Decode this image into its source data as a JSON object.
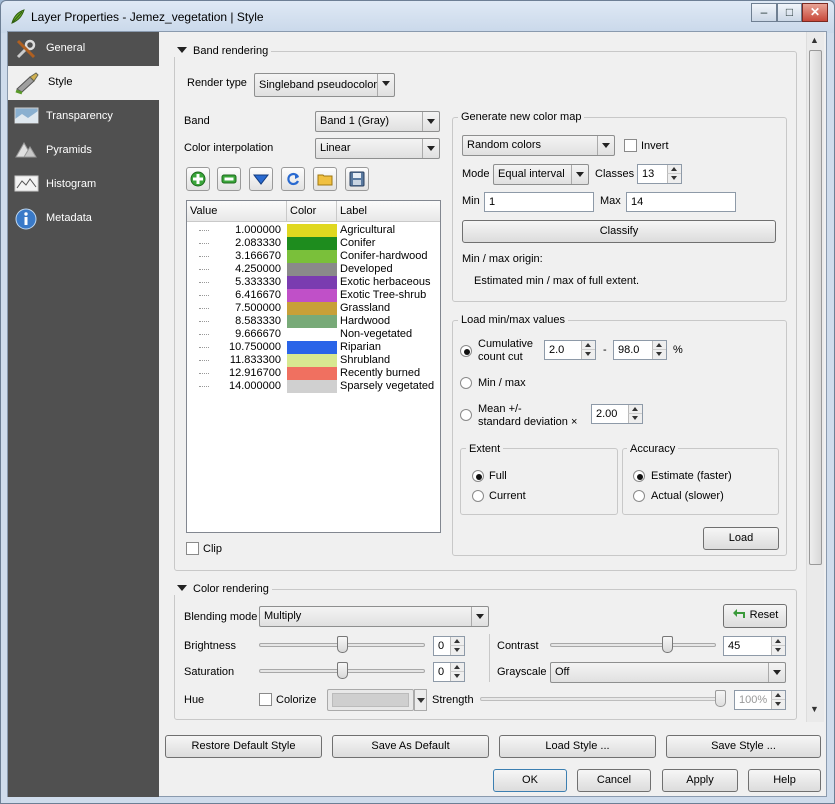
{
  "window": {
    "title": "Layer Properties - Jemez_vegetation | Style",
    "min": "–",
    "max": "□",
    "close": "✕"
  },
  "sidebar": {
    "items": [
      {
        "label": "General",
        "icon": "wrench-icon"
      },
      {
        "label": "Style",
        "icon": "paintbrush-icon"
      },
      {
        "label": "Transparency",
        "icon": "transparency-icon"
      },
      {
        "label": "Pyramids",
        "icon": "pyramids-icon"
      },
      {
        "label": "Histogram",
        "icon": "histogram-icon"
      },
      {
        "label": "Metadata",
        "icon": "info-icon"
      }
    ],
    "active": 1
  },
  "band_rendering": {
    "title": "Band rendering",
    "render_type_label": "Render type",
    "render_type_value": "Singleband pseudocolor",
    "band_label": "Band",
    "band_value": "Band 1 (Gray)",
    "interp_label": "Color interpolation",
    "interp_value": "Linear",
    "table": {
      "headers": [
        "Value",
        "Color",
        "Label"
      ],
      "rows": [
        {
          "value": "1.000000",
          "color": "#e0d820",
          "label": "Agricultural"
        },
        {
          "value": "2.083330",
          "color": "#1e8c1e",
          "label": "Conifer"
        },
        {
          "value": "3.166670",
          "color": "#7ac03a",
          "label": "Conifer-hardwood"
        },
        {
          "value": "4.250000",
          "color": "#8a8a8a",
          "label": "Developed"
        },
        {
          "value": "5.333330",
          "color": "#7a3cb0",
          "label": "Exotic herbaceous"
        },
        {
          "value": "6.416670",
          "color": "#c050c8",
          "label": "Exotic Tree-shrub"
        },
        {
          "value": "7.500000",
          "color": "#c8a038",
          "label": "Grassland"
        },
        {
          "value": "8.583330",
          "color": "#78aa78",
          "label": "Hardwood"
        },
        {
          "value": "9.666670",
          "color": "#ffffff",
          "label": "Non-vegetated"
        },
        {
          "value": "10.750000",
          "color": "#2a64e8",
          "label": "Riparian"
        },
        {
          "value": "11.833300",
          "color": "#d8e890",
          "label": "Shrubland"
        },
        {
          "value": "12.916700",
          "color": "#f07060",
          "label": "Recently burned"
        },
        {
          "value": "14.000000",
          "color": "#d0d0d0",
          "label": "Sparsely vegetated"
        }
      ]
    },
    "clip_label": "Clip"
  },
  "generate": {
    "title": "Generate new color map",
    "ramp_value": "Random colors",
    "invert_label": "Invert",
    "mode_label": "Mode",
    "mode_value": "Equal interval",
    "classes_label": "Classes",
    "classes_value": "13",
    "min_label": "Min",
    "min_value": "1",
    "max_label": "Max",
    "max_value": "14",
    "classify_label": "Classify",
    "origin_label": "Min / max origin:",
    "origin_value": "Estimated min / max of full extent."
  },
  "minmax": {
    "title": "Load min/max values",
    "cumulative_label_1": "Cumulative",
    "cumulative_label_2": "count cut",
    "cut_low": "2.0",
    "cut_dash": "-",
    "cut_high": "98.0",
    "cut_unit": "%",
    "minmax_label": "Min / max",
    "mean_label_1": "Mean +/-",
    "mean_label_2": "standard deviation ×",
    "stddev_value": "2.00",
    "extent_title": "Extent",
    "extent_full": "Full",
    "extent_current": "Current",
    "accuracy_title": "Accuracy",
    "accuracy_estimate": "Estimate (faster)",
    "accuracy_actual": "Actual (slower)",
    "load_label": "Load"
  },
  "color_rendering": {
    "title": "Color rendering",
    "blending_label": "Blending mode",
    "blending_value": "Multiply",
    "reset_label": "Reset",
    "brightness_label": "Brightness",
    "brightness_value": "0",
    "contrast_label": "Contrast",
    "contrast_value": "45",
    "saturation_label": "Saturation",
    "saturation_value": "0",
    "grayscale_label": "Grayscale",
    "grayscale_value": "Off",
    "hue_label": "Hue",
    "colorize_label": "Colorize",
    "strength_label": "Strength",
    "strength_value": "100%"
  },
  "footer": {
    "restore": "Restore Default Style",
    "save_default": "Save As Default",
    "load_style": "Load Style ...",
    "save_style": "Save Style ...",
    "ok": "OK",
    "cancel": "Cancel",
    "apply": "Apply",
    "help": "Help"
  }
}
